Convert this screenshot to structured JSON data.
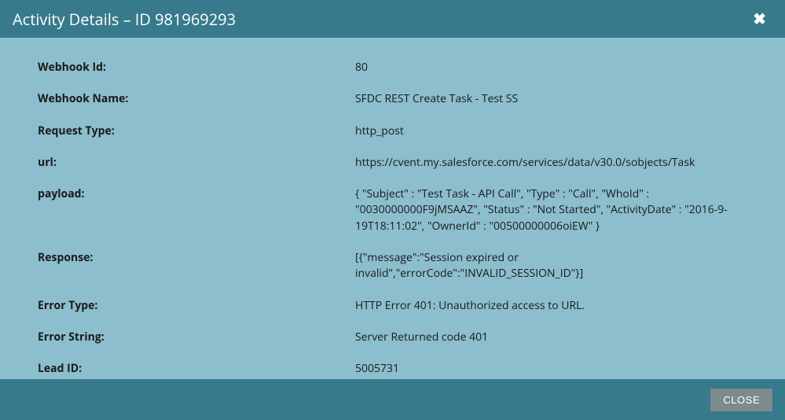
{
  "header": {
    "title": "Activity Details – ID 981969293"
  },
  "details": [
    {
      "label": "Webhook Id:",
      "value": "80"
    },
    {
      "label": "Webhook Name:",
      "value": "SFDC REST Create Task - Test SS"
    },
    {
      "label": "Request Type:",
      "value": "http_post"
    },
    {
      "label": "url:",
      "value": "https://cvent.my.salesforce.com/services/data/v30.0/sobjects/Task"
    },
    {
      "label": "payload:",
      "value": "{ \"Subject\" : \"Test Task - API Call\", \"Type\" : \"Call\", \"WhoId\" : \"0030000000F9jMSAAZ\", \"Status\" : \"Not Started\", \"ActivityDate\" : \"2016-9-19T18:11:02\", \"OwnerId\" : \"00500000006oiEW\" }"
    },
    {
      "label": "Response:",
      "value": "[{\"message\":\"Session expired or invalid\",\"errorCode\":\"INVALID_SESSION_ID\"}]"
    },
    {
      "label": "Error Type:",
      "value": "HTTP Error 401: Unauthorized access to URL."
    },
    {
      "label": "Error String:",
      "value": "Server Returned code 401"
    },
    {
      "label": "Lead ID:",
      "value": "5005731"
    }
  ],
  "footer": {
    "close_label": "CLOSE"
  }
}
